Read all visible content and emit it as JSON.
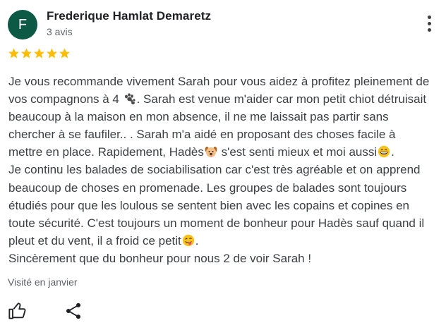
{
  "review": {
    "avatar_letter": "F",
    "avatar_color": "#0c5945",
    "author": "Frederique Hamlat Demaretz",
    "review_count": "3 avis",
    "rating": 5,
    "rating_max": 5,
    "star_color": "#fbbc04",
    "text_part1": "Je vous recommande vivement Sarah pour vous aidez à profitez pleinement de\nvos compagnons à 4 ",
    "text_part2": ". Sarah est venue m'aider car mon petit chiot détruisait\nbeaucoup à la maison en mon absence, il ne me laissait pas partir sans\nchercher à se faufiler.. . Sarah m'a aidé en proposant des choses facile à\nmettre en place. Rapidement, Hadès",
    "text_part3": " s'est senti mieux et moi aussi",
    "text_part4": ".\nJe continu les balades de sociabilisation car c'est très agréable et on apprend\nbeaucoup de choses en promenade. Les groupes de balades sont toujours\nétudiés pour que les loulous se sentent bien avec les copains et copines en\ntoute sécurité. C'est toujours un moment de bonheur pour Hadès sauf quand il\npleut et du vent, il a froid ce petit",
    "text_part5": ".\nSincèrement que du bonheur pour nous 2 de voir Sarah !",
    "emojis": [
      "paw-prints-emoji",
      "dog-face-emoji",
      "grinning-emoji",
      "face-savoring-emoji"
    ],
    "visited": "Visité en janvier",
    "icons": [
      "more-vert-icon",
      "star-icon",
      "thumb-up-icon",
      "share-icon"
    ]
  }
}
